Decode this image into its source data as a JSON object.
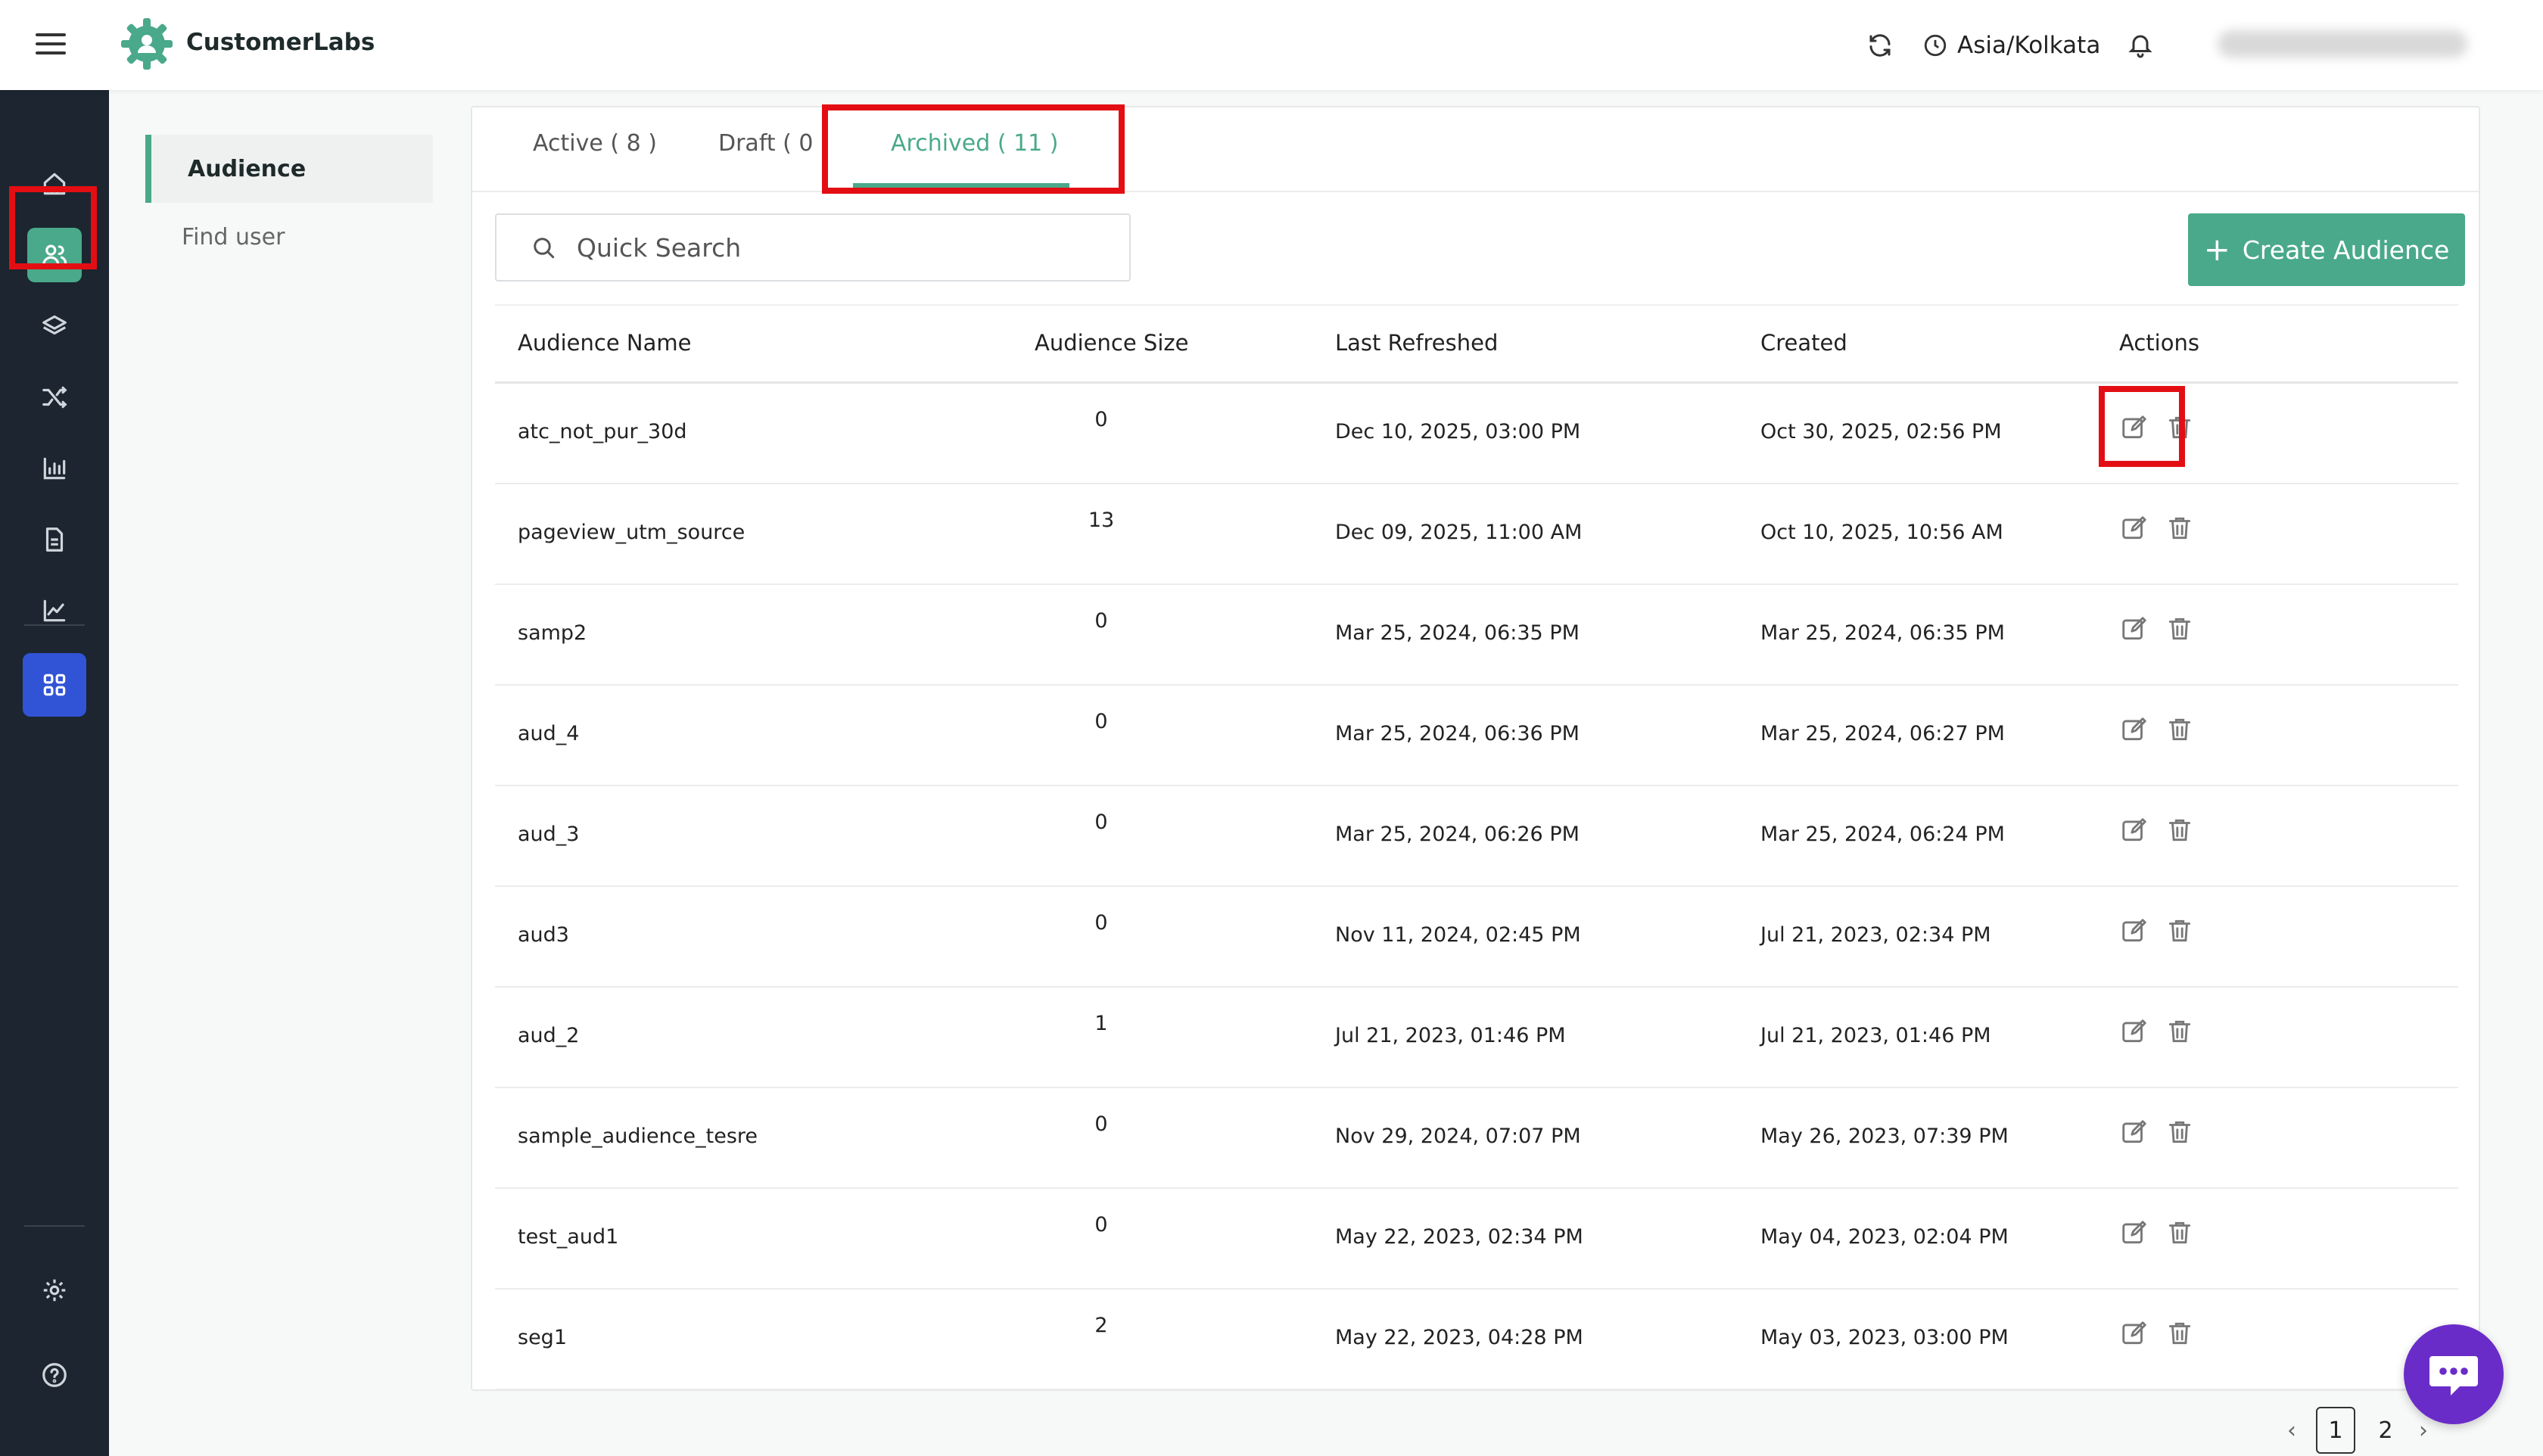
{
  "app": {
    "name": "CustomerLabs"
  },
  "header": {
    "timezone": "Asia/Kolkata"
  },
  "sidebar": {
    "items": [
      {
        "name": "home-icon"
      },
      {
        "name": "users-icon",
        "active": true
      },
      {
        "name": "layers-icon"
      },
      {
        "name": "shuffle-icon"
      },
      {
        "name": "bar-chart-icon"
      },
      {
        "name": "document-icon"
      },
      {
        "name": "line-chart-icon"
      },
      {
        "name": "apps-grid-icon"
      }
    ],
    "bottom": [
      {
        "name": "gear-icon"
      },
      {
        "name": "help-icon"
      }
    ]
  },
  "subnav": {
    "items": [
      {
        "label": "Audience",
        "active": true
      },
      {
        "label": "Find user"
      }
    ]
  },
  "tabs": [
    {
      "label": "Active ( 8 )"
    },
    {
      "label": "Draft ( 0 )"
    },
    {
      "label": "Archived ( 11 )",
      "active": true
    }
  ],
  "search": {
    "placeholder": "Quick Search"
  },
  "create_button": {
    "label": "Create Audience"
  },
  "table": {
    "headers": [
      "Audience Name",
      "Audience Size",
      "Last Refreshed",
      "Created",
      "Actions"
    ],
    "rows": [
      {
        "name": "atc_not_pur_30d",
        "size": "0",
        "last_refreshed": "Dec 10, 2025, 03:00 PM",
        "created": "Oct 30, 2025, 02:56 PM"
      },
      {
        "name": "pageview_utm_source",
        "size": "13",
        "last_refreshed": "Dec 09, 2025, 11:00 AM",
        "created": "Oct 10, 2025, 10:56 AM"
      },
      {
        "name": "samp2",
        "size": "0",
        "last_refreshed": "Mar 25, 2024, 06:35 PM",
        "created": "Mar 25, 2024, 06:35 PM"
      },
      {
        "name": "aud_4",
        "size": "0",
        "last_refreshed": "Mar 25, 2024, 06:36 PM",
        "created": "Mar 25, 2024, 06:27 PM"
      },
      {
        "name": "aud_3",
        "size": "0",
        "last_refreshed": "Mar 25, 2024, 06:26 PM",
        "created": "Mar 25, 2024, 06:24 PM"
      },
      {
        "name": "aud3",
        "size": "0",
        "last_refreshed": "Nov 11, 2024, 02:45 PM",
        "created": "Jul 21, 2023, 02:34 PM"
      },
      {
        "name": "aud_2",
        "size": "1",
        "last_refreshed": "Jul 21, 2023, 01:46 PM",
        "created": "Jul 21, 2023, 01:46 PM"
      },
      {
        "name": "sample_audience_tesre",
        "size": "0",
        "last_refreshed": "Nov 29, 2024, 07:07 PM",
        "created": "May 26, 2023, 07:39 PM"
      },
      {
        "name": "test_aud1",
        "size": "0",
        "last_refreshed": "May 22, 2023, 02:34 PM",
        "created": "May 04, 2023, 02:04 PM"
      },
      {
        "name": "seg1",
        "size": "2",
        "last_refreshed": "May 22, 2023, 04:28 PM",
        "created": "May 03, 2023, 03:00 PM"
      }
    ]
  },
  "pagination": {
    "prev": "‹",
    "pages": [
      "1",
      "2"
    ],
    "current": "1",
    "next": "›"
  },
  "colors": {
    "accent": "#4aa98a",
    "rail": "#1c2530",
    "highlight": "#e30e13",
    "apps": "#3154d6",
    "chat": "#6a2cc9"
  }
}
